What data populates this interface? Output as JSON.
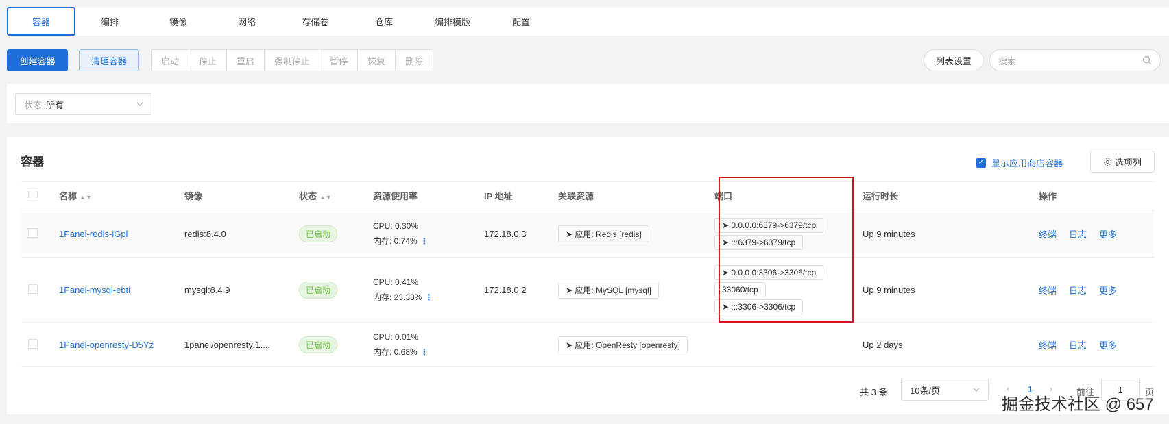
{
  "tabs": [
    "容器",
    "编排",
    "镜像",
    "网络",
    "存储卷",
    "仓库",
    "编排模版",
    "配置"
  ],
  "toolbar": {
    "create": "创建容器",
    "clean": "清理容器",
    "group": [
      "启动",
      "停止",
      "重启",
      "强制停止",
      "暂停",
      "恢复",
      "删除"
    ],
    "list_settings": "列表设置",
    "search_placeholder": "搜索"
  },
  "filter": {
    "prefix": "状态",
    "value": "所有"
  },
  "card": {
    "title": "容器",
    "show_store": "显示应用商店容器",
    "columns_btn": "选项列"
  },
  "table": {
    "headers": [
      "名称",
      "镜像",
      "状态",
      "资源使用率",
      "IP 地址",
      "关联资源",
      "端口",
      "运行时长",
      "操作"
    ],
    "rows": [
      {
        "name": "1Panel-redis-iGpl",
        "image": "redis:8.4.0",
        "status": "已启动",
        "cpu": "CPU: 0.30%",
        "mem": "内存: 0.74%",
        "ip": "172.18.0.3",
        "resource": "应用: Redis [redis]",
        "ports": [
          "0.0.0.0:6379->6379/tcp",
          ":::6379->6379/tcp"
        ],
        "uptime": "Up 9 minutes"
      },
      {
        "name": "1Panel-mysql-ebti",
        "image": "mysql:8.4.9",
        "status": "已启动",
        "cpu": "CPU: 0.41%",
        "mem": "内存: 23.33%",
        "ip": "172.18.0.2",
        "resource": "应用: MySQL [mysql]",
        "ports": [
          "0.0.0.0:3306->3306/tcp",
          "33060/tcp",
          ":::3306->3306/tcp"
        ],
        "uptime": "Up 9 minutes"
      },
      {
        "name": "1Panel-openresty-D5Yz",
        "image": "1panel/openresty:1....",
        "status": "已启动",
        "cpu": "CPU: 0.01%",
        "mem": "内存: 0.68%",
        "ip": "",
        "resource": "应用: OpenResty [openresty]",
        "ports": [],
        "uptime": "Up 2 days"
      }
    ],
    "ops": [
      "终端",
      "日志",
      "更多"
    ]
  },
  "pagination": {
    "total": "共 3 条",
    "size": "10条/页",
    "page": "1",
    "goto": "前往",
    "unit": "页"
  },
  "watermark": "掘金技术社区 @ 657"
}
